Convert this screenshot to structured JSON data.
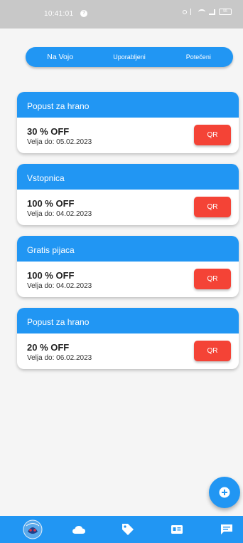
{
  "status_bar": {
    "time": "10:41:01",
    "battery": "55"
  },
  "tabs": [
    {
      "label": "Na Vojo",
      "active": true
    },
    {
      "label": "Uporabljeni",
      "active": false
    },
    {
      "label": "Potečeni",
      "active": false
    }
  ],
  "coupons": [
    {
      "title": "Popust za hrano",
      "discount": "30 % OFF",
      "valid": "Velja do: 05.02.2023",
      "button": "QR"
    },
    {
      "title": "Vstopnica",
      "discount": "100 % OFF",
      "valid": "Velja do: 04.02.2023",
      "button": "QR"
    },
    {
      "title": "Gratis pijaca",
      "discount": "100 % OFF",
      "valid": "Velja do: 04.02.2023",
      "button": "QR"
    },
    {
      "title": "Popust za hrano",
      "discount": "20 % OFF",
      "valid": "Velja do: 06.02.2023",
      "button": "QR"
    }
  ],
  "fab": {
    "icon": "add-circle-icon"
  },
  "bottom_nav": [
    {
      "icon": "logo-icon"
    },
    {
      "icon": "cloud-icon"
    },
    {
      "icon": "tag-icon"
    },
    {
      "icon": "id-card-icon"
    },
    {
      "icon": "chat-icon"
    }
  ],
  "colors": {
    "primary": "#2196f3",
    "accent": "#f44336",
    "background": "#f5f5f5"
  }
}
